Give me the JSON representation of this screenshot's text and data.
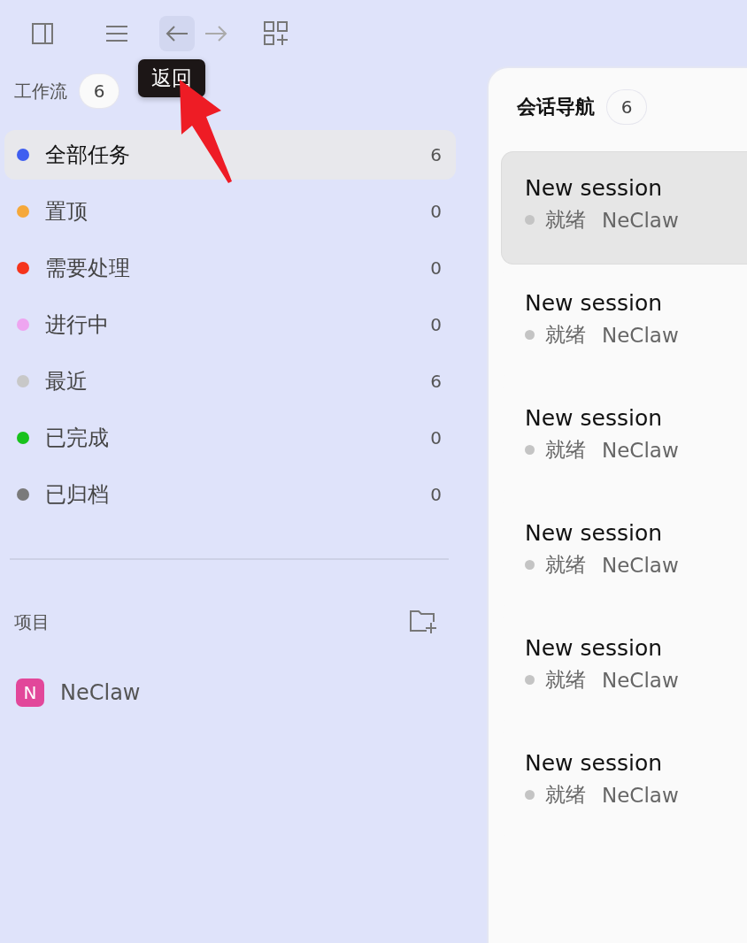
{
  "toolbar": [
    {
      "kind": "sidebar",
      "highlighted": false
    },
    {
      "kind": "menu",
      "highlighted": false
    },
    {
      "kind": "back",
      "highlighted": true
    },
    {
      "kind": "forward",
      "highlighted": false
    },
    {
      "kind": "add-widget",
      "highlighted": false
    }
  ],
  "tooltip": {
    "text": "返回"
  },
  "workflow": {
    "title": "工作流",
    "count": "6",
    "items": [
      {
        "label": "全部任务",
        "count": "6",
        "color": "#3f5ef0",
        "selected": true
      },
      {
        "label": "置顶",
        "count": "0",
        "color": "#f5a83a",
        "selected": false
      },
      {
        "label": "需要处理",
        "count": "0",
        "color": "#f5341c",
        "selected": false
      },
      {
        "label": "进行中",
        "count": "0",
        "color": "#eea5f0",
        "selected": false
      },
      {
        "label": "最近",
        "count": "6",
        "color": "#c8c8c8",
        "selected": false
      },
      {
        "label": "已完成",
        "count": "0",
        "color": "#18c21c",
        "selected": false
      },
      {
        "label": "已归档",
        "count": "0",
        "color": "#7a7a7a",
        "selected": false
      }
    ]
  },
  "projects": {
    "title": "项目",
    "items": [
      {
        "initial": "N",
        "name": "NeClaw"
      }
    ]
  },
  "sessions": {
    "title": "会话导航",
    "count": "6",
    "items": [
      {
        "title": "New session",
        "status": "就绪",
        "project": "NeClaw",
        "selected": true
      },
      {
        "title": "New session",
        "status": "就绪",
        "project": "NeClaw",
        "selected": false
      },
      {
        "title": "New session",
        "status": "就绪",
        "project": "NeClaw",
        "selected": false
      },
      {
        "title": "New session",
        "status": "就绪",
        "project": "NeClaw",
        "selected": false
      },
      {
        "title": "New session",
        "status": "就绪",
        "project": "NeClaw",
        "selected": false
      },
      {
        "title": "New session",
        "status": "就绪",
        "project": "NeClaw",
        "selected": false
      }
    ]
  }
}
